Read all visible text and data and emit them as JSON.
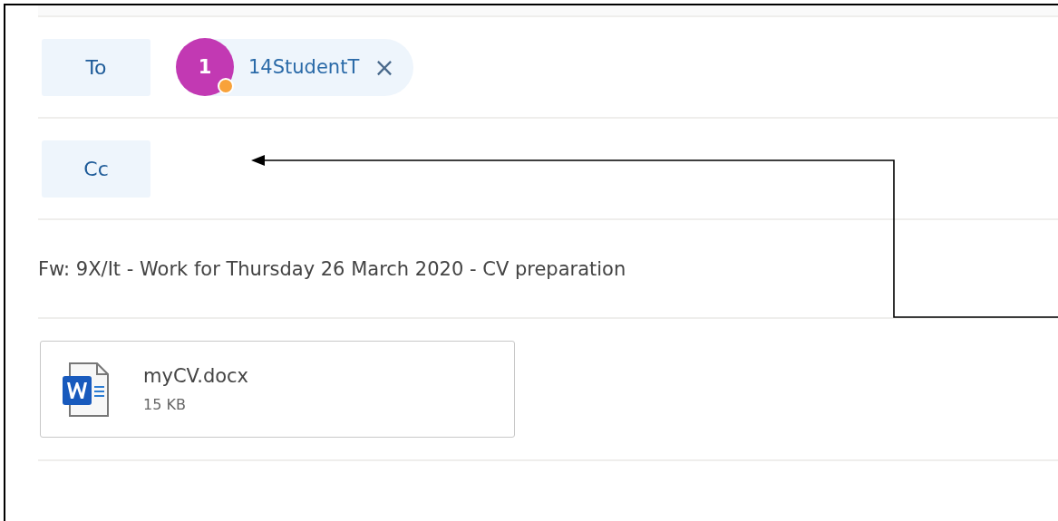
{
  "recipients_to": {
    "label": "To",
    "people": [
      {
        "initial": "1",
        "name": "14StudentT",
        "remove": "×",
        "color": "#f8a23a"
      }
    ]
  },
  "recipients_cc": {
    "label": "Cc"
  },
  "subject": "Fw: 9X/It - Work for Thursday 26 March 2020 - CV preparation",
  "attachments": [
    {
      "name": "myCV.docx",
      "size": "15 KB",
      "kind": "word"
    }
  ],
  "annotation": {
    "kind": "arrow"
  }
}
